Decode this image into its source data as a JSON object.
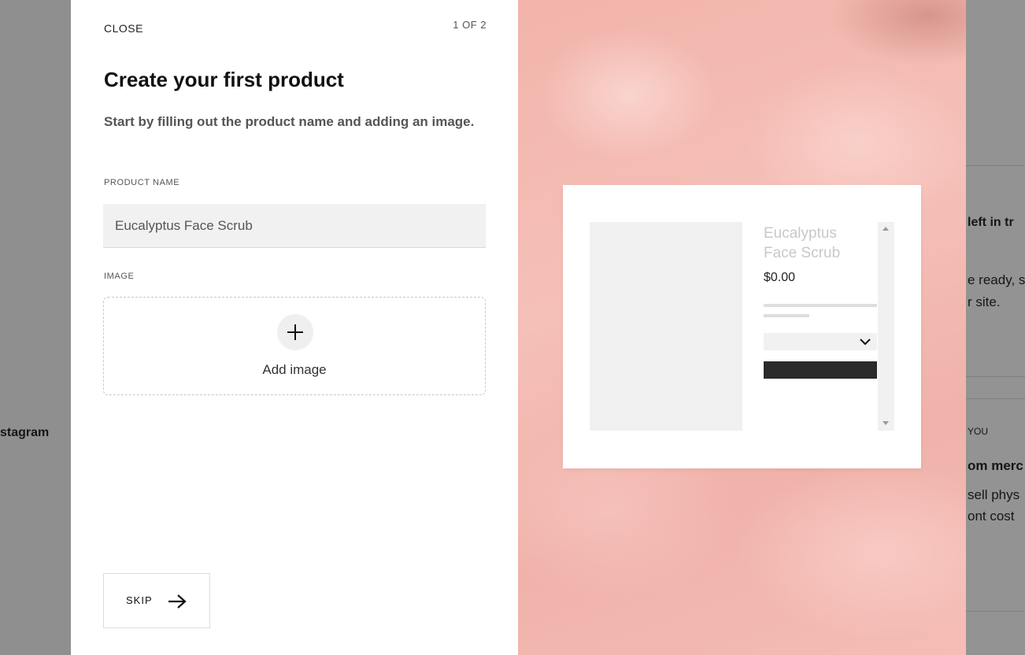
{
  "background": {
    "left_text": "stagram",
    "right_texts": {
      "left_in_trial": "left in tr",
      "ready": "e ready, s",
      "site": "r site.",
      "you": "YOU",
      "merch": "om merc",
      "sell": "sell phys",
      "cost": "ont cost"
    }
  },
  "modal": {
    "close_label": "CLOSE",
    "step": "1 OF 2",
    "title": "Create your first product",
    "subtitle": "Start by filling out the product name and adding an image.",
    "product_name_label": "PRODUCT NAME",
    "product_name_value": "Eucalyptus Face Scrub",
    "image_label": "IMAGE",
    "add_image_label": "Add image",
    "skip_label": "SKIP"
  },
  "preview": {
    "product_name": "Eucalyptus Face Scrub",
    "price": "$0.00"
  },
  "icons": [
    "plus-icon",
    "arrow-right-icon",
    "chevron-down-icon",
    "scroll-up-icon",
    "scroll-down-icon"
  ],
  "colors": {
    "overlay": "#8f8f8f",
    "modal_bg": "#ffffff",
    "preview_bg": "#f3b8b0",
    "button_dark": "#2a2a2a"
  }
}
